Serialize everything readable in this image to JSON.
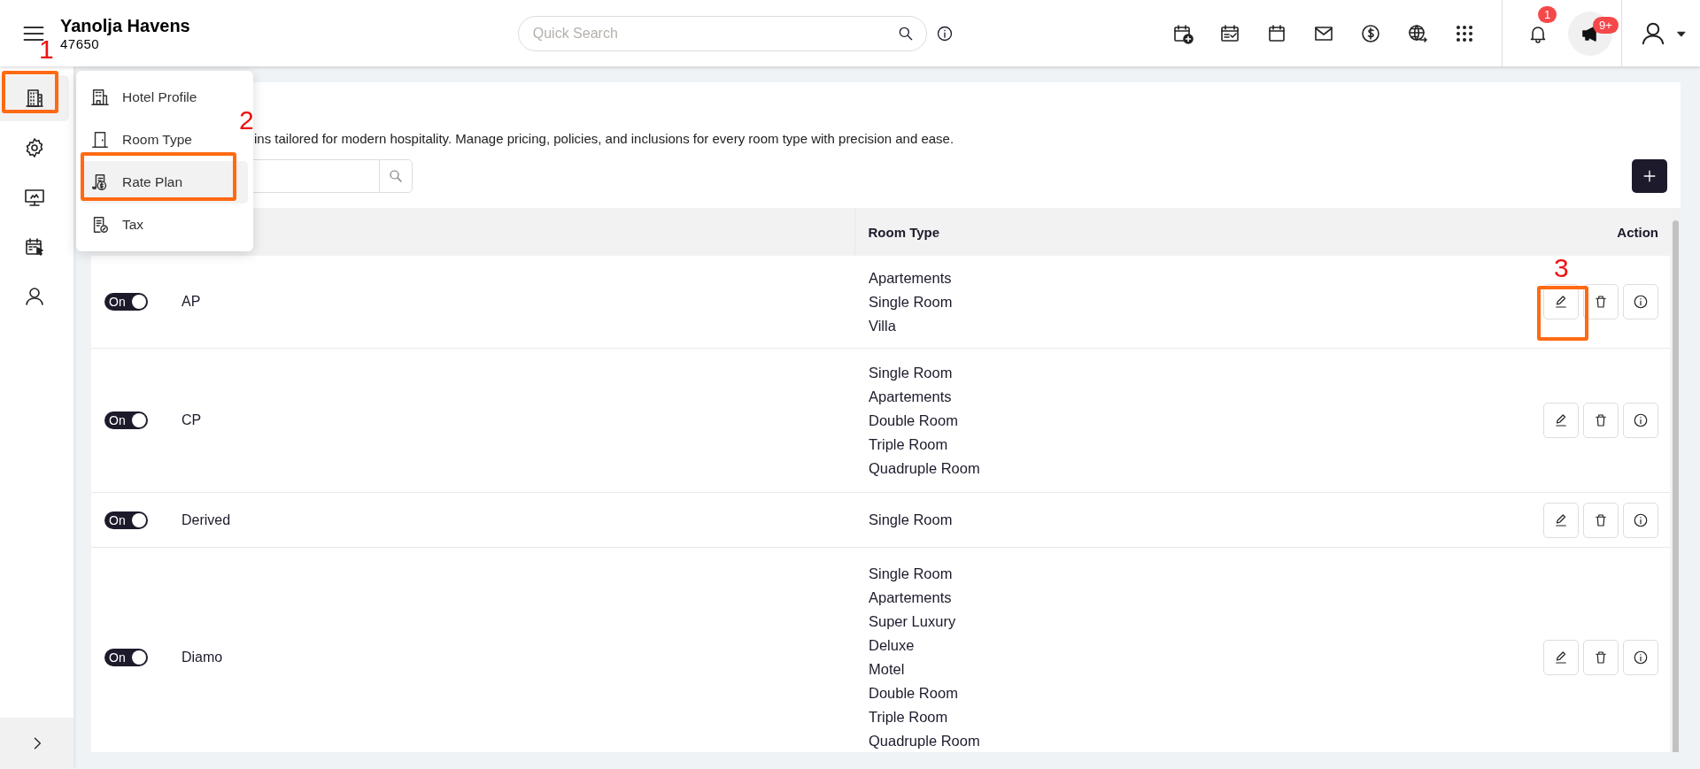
{
  "header": {
    "property_name": "Yanolja Havens",
    "property_code": "47650",
    "search": {
      "placeholder": "Quick Search"
    },
    "shortcuts": [
      {
        "kind": "calendar-plus"
      },
      {
        "kind": "calendar-check"
      },
      {
        "kind": "calendar"
      },
      {
        "kind": "mail"
      },
      {
        "kind": "dollar"
      },
      {
        "kind": "globe"
      },
      {
        "kind": "apps"
      }
    ],
    "notifications": {
      "count": "1"
    },
    "announcements": {
      "count": "9+"
    }
  },
  "sidebar": {
    "items": [
      {
        "kind": "building",
        "selected": true
      },
      {
        "kind": "gear",
        "selected": false
      },
      {
        "kind": "monitor",
        "selected": false
      },
      {
        "kind": "calendar",
        "selected": false
      },
      {
        "kind": "user",
        "selected": false
      }
    ]
  },
  "menu": {
    "items": [
      {
        "label": "Hotel Profile",
        "kind": "hotel",
        "selected": false
      },
      {
        "label": "Room Type",
        "kind": "door",
        "selected": false
      },
      {
        "label": "Rate Plan",
        "kind": "rate",
        "selected": true
      },
      {
        "label": "Tax",
        "kind": "tax",
        "selected": false
      }
    ]
  },
  "page": {
    "description": "ins tailored for modern hospitality. Manage pricing, policies, and inclusions for every room type with precision and ease."
  },
  "table": {
    "columns": [
      "Room Type",
      "Action"
    ],
    "rows": [
      {
        "toggle_label": "On",
        "on": true,
        "rate_plan": "AP",
        "room_types": [
          "Apartements",
          "Single Room",
          "Villa"
        ]
      },
      {
        "toggle_label": "On",
        "on": true,
        "rate_plan": "CP",
        "room_types": [
          "Single Room",
          "Apartements",
          "Double Room",
          "Triple Room",
          "Quadruple Room"
        ]
      },
      {
        "toggle_label": "On",
        "on": true,
        "rate_plan": "Derived",
        "room_types": [
          "Single Room"
        ]
      },
      {
        "toggle_label": "On",
        "on": true,
        "rate_plan": "Diamo",
        "room_types": [
          "Single Room",
          "Apartements",
          "Super Luxury",
          "Deluxe",
          "Motel",
          "Double Room",
          "Triple Room",
          "Quadruple Room"
        ]
      }
    ]
  },
  "annotations": [
    {
      "label": "1"
    },
    {
      "label": "2"
    },
    {
      "label": "3"
    }
  ]
}
